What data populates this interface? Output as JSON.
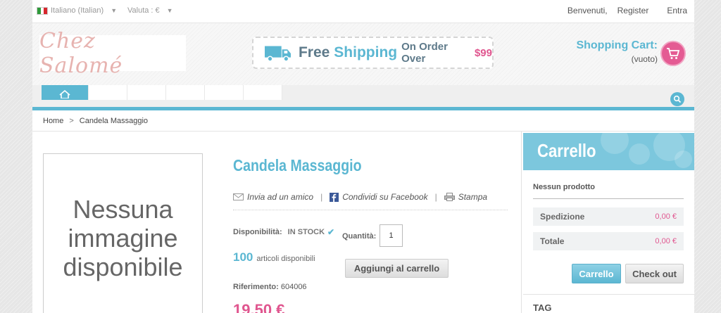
{
  "topbar": {
    "language": "Italiano (Italian)",
    "currency": "Valuta : €",
    "welcome": "Benvenuti,",
    "register": "Register",
    "login": "Entra"
  },
  "header": {
    "logo_text": "Chez Salomé",
    "shipping": {
      "free": "Free",
      "shipping": "Shipping",
      "on_order": "On Order Over",
      "amount": "$99"
    },
    "cart_label": "Shopping Cart:",
    "cart_status": "(vuoto)"
  },
  "breadcrumb": {
    "home": "Home",
    "separator": ">",
    "current": "Candela Massaggio"
  },
  "product": {
    "no_image": "Nessuna immagine disponibile",
    "title": "Candela Massaggio",
    "share": {
      "send_friend": "Invia ad un amico",
      "facebook": "Condividi su Facebook",
      "print": "Stampa"
    },
    "availability_label": "Disponibilità:",
    "availability_value": "IN STOCK",
    "quantity_label": "Quantità:",
    "quantity_value": "1",
    "items_count": "100",
    "items_text": "articoli disponibili",
    "add_to_cart": "Aggiungi al carrello",
    "reference_label": "Riferimento:",
    "reference_value": "604006",
    "price": "19,50 €"
  },
  "sidebar": {
    "cart_title": "Carrello",
    "empty": "Nessun prodotto",
    "shipping_label": "Spedizione",
    "shipping_value": "0,00 €",
    "total_label": "Totale",
    "total_value": "0,00 €",
    "cart_button": "Carrello",
    "checkout_button": "Check out",
    "tag_title": "TAG"
  },
  "colors": {
    "accent": "#5bb7d2",
    "pink": "#e0568f"
  }
}
